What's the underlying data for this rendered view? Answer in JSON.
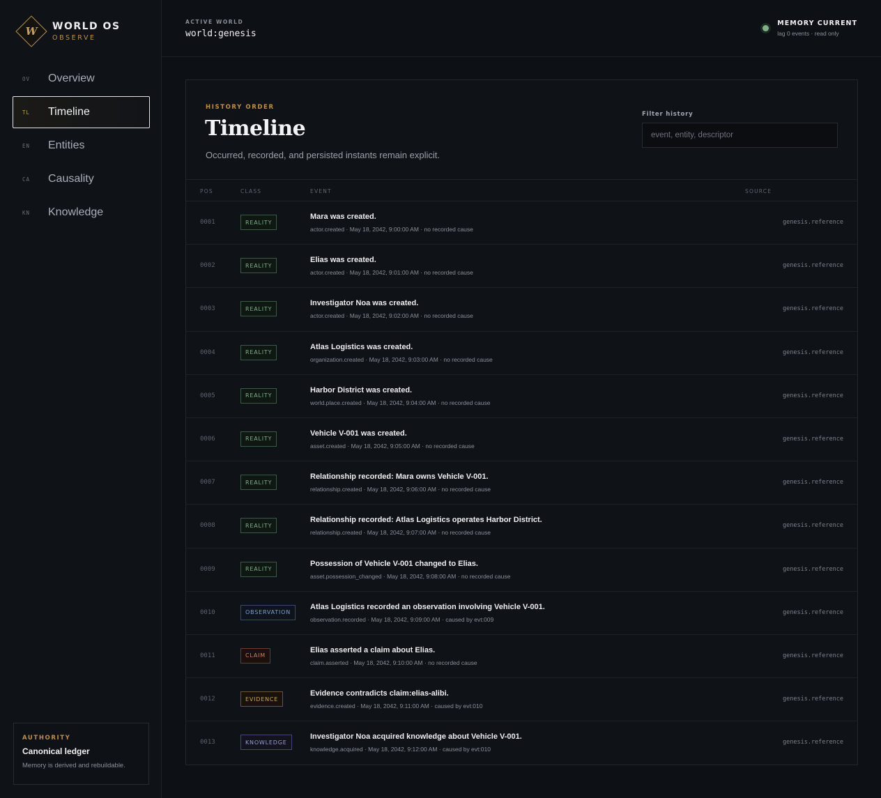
{
  "brand": {
    "title": "WORLD OS",
    "subtitle": "OBSERVE",
    "logo_letter": "W"
  },
  "nav": [
    {
      "code": "OV",
      "label": "Overview",
      "active": false
    },
    {
      "code": "TL",
      "label": "Timeline",
      "active": true
    },
    {
      "code": "EN",
      "label": "Entities",
      "active": false
    },
    {
      "code": "CA",
      "label": "Causality",
      "active": false
    },
    {
      "code": "KN",
      "label": "Knowledge",
      "active": false
    }
  ],
  "authority": {
    "kicker": "AUTHORITY",
    "title": "Canonical ledger",
    "desc": "Memory is derived and rebuildable."
  },
  "header": {
    "world_kicker": "ACTIVE WORLD",
    "world_value": "world:genesis",
    "memory_title": "MEMORY CURRENT",
    "memory_sub": "lag 0 events · read only",
    "status_color": "#7fb08a"
  },
  "panel": {
    "kicker": "HISTORY ORDER",
    "title": "Timeline",
    "desc": "Occurred, recorded, and persisted instants remain explicit.",
    "filter_label": "Filter history",
    "filter_placeholder": "event, entity, descriptor",
    "filter_value": ""
  },
  "columns": {
    "pos": "POS",
    "class": "CLASS",
    "event": "EVENT",
    "source": "SOURCE"
  },
  "rows": [
    {
      "pos": "0001",
      "cls": "REALITY",
      "kind": "reality",
      "title": "Mara was created.",
      "meta": "actor.created · May 18, 2042, 9:00:00 AM · no recorded cause",
      "source": "genesis.reference"
    },
    {
      "pos": "0002",
      "cls": "REALITY",
      "kind": "reality",
      "title": "Elias was created.",
      "meta": "actor.created · May 18, 2042, 9:01:00 AM · no recorded cause",
      "source": "genesis.reference"
    },
    {
      "pos": "0003",
      "cls": "REALITY",
      "kind": "reality",
      "title": "Investigator Noa was created.",
      "meta": "actor.created · May 18, 2042, 9:02:00 AM · no recorded cause",
      "source": "genesis.reference"
    },
    {
      "pos": "0004",
      "cls": "REALITY",
      "kind": "reality",
      "title": "Atlas Logistics was created.",
      "meta": "organization.created · May 18, 2042, 9:03:00 AM · no recorded cause",
      "source": "genesis.reference"
    },
    {
      "pos": "0005",
      "cls": "REALITY",
      "kind": "reality",
      "title": "Harbor District was created.",
      "meta": "world.place.created · May 18, 2042, 9:04:00 AM · no recorded cause",
      "source": "genesis.reference"
    },
    {
      "pos": "0006",
      "cls": "REALITY",
      "kind": "reality",
      "title": "Vehicle V-001 was created.",
      "meta": "asset.created · May 18, 2042, 9:05:00 AM · no recorded cause",
      "source": "genesis.reference"
    },
    {
      "pos": "0007",
      "cls": "REALITY",
      "kind": "reality",
      "title": "Relationship recorded: Mara owns Vehicle V-001.",
      "meta": "relationship.created · May 18, 2042, 9:06:00 AM · no recorded cause",
      "source": "genesis.reference"
    },
    {
      "pos": "0008",
      "cls": "REALITY",
      "kind": "reality",
      "title": "Relationship recorded: Atlas Logistics operates Harbor District.",
      "meta": "relationship.created · May 18, 2042, 9:07:00 AM · no recorded cause",
      "source": "genesis.reference"
    },
    {
      "pos": "0009",
      "cls": "REALITY",
      "kind": "reality",
      "title": "Possession of Vehicle V-001 changed to Elias.",
      "meta": "asset.possession_changed · May 18, 2042, 9:08:00 AM · no recorded cause",
      "source": "genesis.reference"
    },
    {
      "pos": "0010",
      "cls": "OBSERVATION",
      "kind": "observation",
      "title": "Atlas Logistics recorded an observation involving Vehicle V-001.",
      "meta": "observation.recorded · May 18, 2042, 9:09:00 AM · caused by evt:009",
      "source": "genesis.reference"
    },
    {
      "pos": "0011",
      "cls": "CLAIM",
      "kind": "claim",
      "title": "Elias asserted a claim about Elias.",
      "meta": "claim.asserted · May 18, 2042, 9:10:00 AM · no recorded cause",
      "source": "genesis.reference"
    },
    {
      "pos": "0012",
      "cls": "EVIDENCE",
      "kind": "evidence",
      "title": "Evidence contradicts claim:elias-alibi.",
      "meta": "evidence.created · May 18, 2042, 9:11:00 AM · caused by evt:010",
      "source": "genesis.reference"
    },
    {
      "pos": "0013",
      "cls": "KNOWLEDGE",
      "kind": "knowledge",
      "title": "Investigator Noa acquired knowledge about Vehicle V-001.",
      "meta": "knowledge.acquired · May 18, 2042, 9:12:00 AM · caused by evt:010",
      "source": "genesis.reference"
    }
  ]
}
